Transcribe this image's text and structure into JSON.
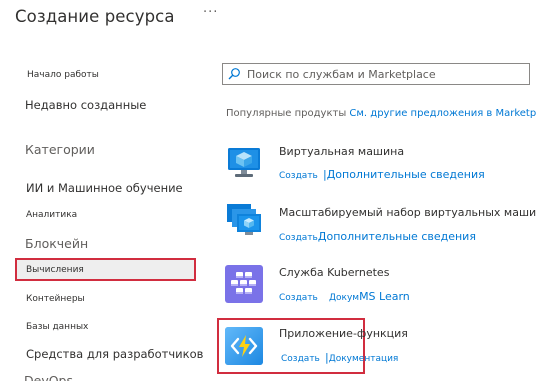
{
  "header": {
    "title": "Создание ресурса",
    "more_label": "···"
  },
  "nav": {
    "start": "Начало работы",
    "recent": "Недавно созданные",
    "categories_heading": "Категории",
    "items": [
      "ИИ и Машинное обучение",
      "Аналитика",
      "Блокчейн",
      "Вычисления",
      "Контейнеры",
      "Базы данных",
      "Средства для разработчиков",
      "DevOps"
    ]
  },
  "search": {
    "placeholder": "Поиск по службам и Marketplace",
    "value": ""
  },
  "popular": {
    "label": "Популярные продукты",
    "more_link": "См. другие предложения в Marketplace"
  },
  "products": [
    {
      "title": "Виртуальная машина",
      "create": "Создать",
      "separator": "|",
      "docs": "Дополнительные сведения",
      "icon": "virtual-machine-icon"
    },
    {
      "title": "Масштабируемый набор виртуальных машин",
      "create": "Создать",
      "separator": "",
      "docs": "Дополнительные сведения",
      "icon": "vm-scale-set-icon"
    },
    {
      "title": "Служба Kubernetes",
      "create": "Создать",
      "separator": "",
      "docs_prefix": "Докум",
      "docs": "MS Learn",
      "icon": "kubernetes-icon"
    },
    {
      "title": "Приложение-функция",
      "create": "Создать",
      "separator": "|",
      "docs": "Документация",
      "icon": "function-app-icon"
    }
  ],
  "colors": {
    "accent": "#0078d4",
    "highlight": "#d12d3f",
    "text": "#323130",
    "muted": "#605e5c"
  }
}
